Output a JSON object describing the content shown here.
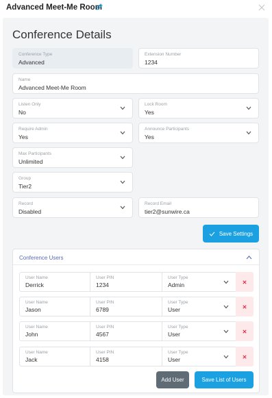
{
  "header": {
    "title": "Advanced Meet-Me Room",
    "edit_icon": "pencil-icon",
    "close_icon": "close-icon"
  },
  "panel": {
    "title": "Conference Details"
  },
  "fields": {
    "conference_type": {
      "label": "Conference Type",
      "value": "Advanced"
    },
    "extension_number": {
      "label": "Extension Number",
      "value": "1234"
    },
    "name": {
      "label": "Name",
      "value": "Advanced Meet-Me Room"
    },
    "listen_only": {
      "label": "Listen Only",
      "value": "No"
    },
    "lock_room": {
      "label": "Lock Room",
      "value": "Yes"
    },
    "require_admin": {
      "label": "Require Admin",
      "value": "Yes"
    },
    "announce_participants": {
      "label": "Announce Participants",
      "value": "Yes"
    },
    "max_participants": {
      "label": "Max Participants",
      "value": "Unlimited"
    },
    "group": {
      "label": "Group",
      "value": "Tier2"
    },
    "record": {
      "label": "Record",
      "value": "Disabled"
    },
    "record_email": {
      "label": "Record Email",
      "value": "tier2@sunwire.ca"
    }
  },
  "save_settings": {
    "label": "Save Settings",
    "icon": "check-icon"
  },
  "users": {
    "title": "Conference Users",
    "col_name": "User Name",
    "col_pin": "User PIN",
    "col_type": "User Type",
    "rows": [
      {
        "name": "Derrick",
        "pin": "1234",
        "type": "Admin"
      },
      {
        "name": "Jason",
        "pin": "6789",
        "type": "User"
      },
      {
        "name": "John",
        "pin": "4567",
        "type": "User"
      },
      {
        "name": "Jack",
        "pin": "4158",
        "type": "User"
      }
    ],
    "add_user": "Add User",
    "save_list": "Save List of Users"
  },
  "colors": {
    "accent": "#1ba1e2",
    "secondary_button": "#5f6b75",
    "delete_bg": "#fde8ea",
    "delete_icon": "#e0344a",
    "section_title": "#5a6ab8"
  }
}
